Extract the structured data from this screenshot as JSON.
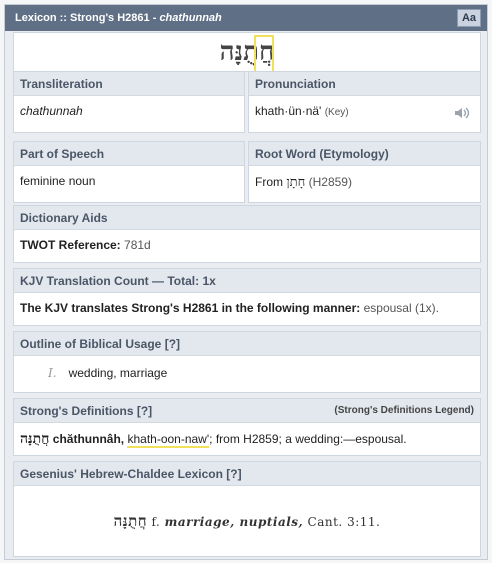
{
  "titlebar": {
    "prefix": "Lexicon :: Strong's H2861 - ",
    "word": "chathunnah",
    "font_button": "Aa"
  },
  "hebrew": {
    "word": "חֲתֻנָּה"
  },
  "transliteration": {
    "label": "Transliteration",
    "value": "chathunnah"
  },
  "pronunciation": {
    "label": "Pronunciation",
    "value": "khath·ün·nä'",
    "key": "(Key)"
  },
  "part_of_speech": {
    "label": "Part of Speech",
    "value": "feminine noun"
  },
  "root_word": {
    "label": "Root Word (Etymology)",
    "from": "From",
    "hebrew": "חָתָן",
    "code": "(H2859)"
  },
  "dictionary_aids": {
    "label": "Dictionary Aids",
    "twot_label": "TWOT Reference:",
    "twot_value": "781d"
  },
  "kjv_count": {
    "label": "KJV Translation Count — Total: 1x",
    "text": "The KJV translates Strong's H2861 in the following manner:",
    "value": "espousal (1x)."
  },
  "outline": {
    "label": "Outline of Biblical Usage [?]",
    "num": "I.",
    "item": "wedding, marriage"
  },
  "strongs": {
    "label": "Strong's Definitions [?]",
    "legend": "(Strong's Definitions Legend)",
    "hebrew": "חֲתֻנָּה",
    "translit": "chăthunnâh,",
    "pron": "khath-oon-naw'",
    "rest": "; from H2859; a wedding:—espousal."
  },
  "gesenius": {
    "label": "Gesenius' Hebrew-Chaldee Lexicon [?]",
    "hebrew": "חֲתֻנָּה",
    "f": "f.",
    "meaning": "marriage, nuptials,",
    "ref": "Cant. 3:11."
  }
}
